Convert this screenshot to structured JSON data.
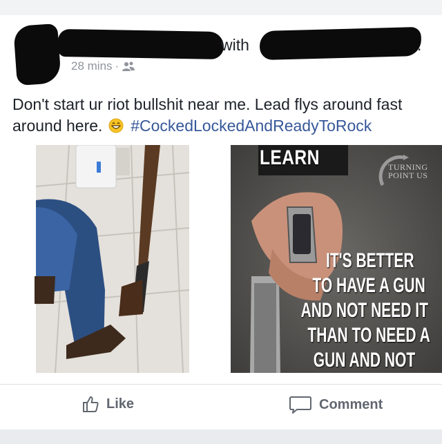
{
  "post": {
    "with_text": "with",
    "trailing_dot": ".",
    "time": "28 mins",
    "separator": "·",
    "privacy_icon": "friends-icon",
    "text_main": "Don't start ur riot bullshit near me. Lead flys around fast around here.",
    "emoji": "grinning-face-emoji",
    "hashtag": "#CockedLockedAndReadyToRock"
  },
  "images": {
    "right": {
      "heading": "LEARN",
      "logo_line1": "TURNING",
      "logo_line2": "POINT US",
      "quote_lines": [
        "IT'S BETTER",
        "TO HAVE A GUN",
        "AND NOT NEED IT",
        "THAN TO NEED A",
        "GUN AND NOT"
      ]
    }
  },
  "actions": {
    "like_label": "Like",
    "comment_label": "Comment"
  },
  "colors": {
    "text": "#1d2129",
    "meta": "#90949c",
    "link": "#365899",
    "action": "#616770"
  }
}
